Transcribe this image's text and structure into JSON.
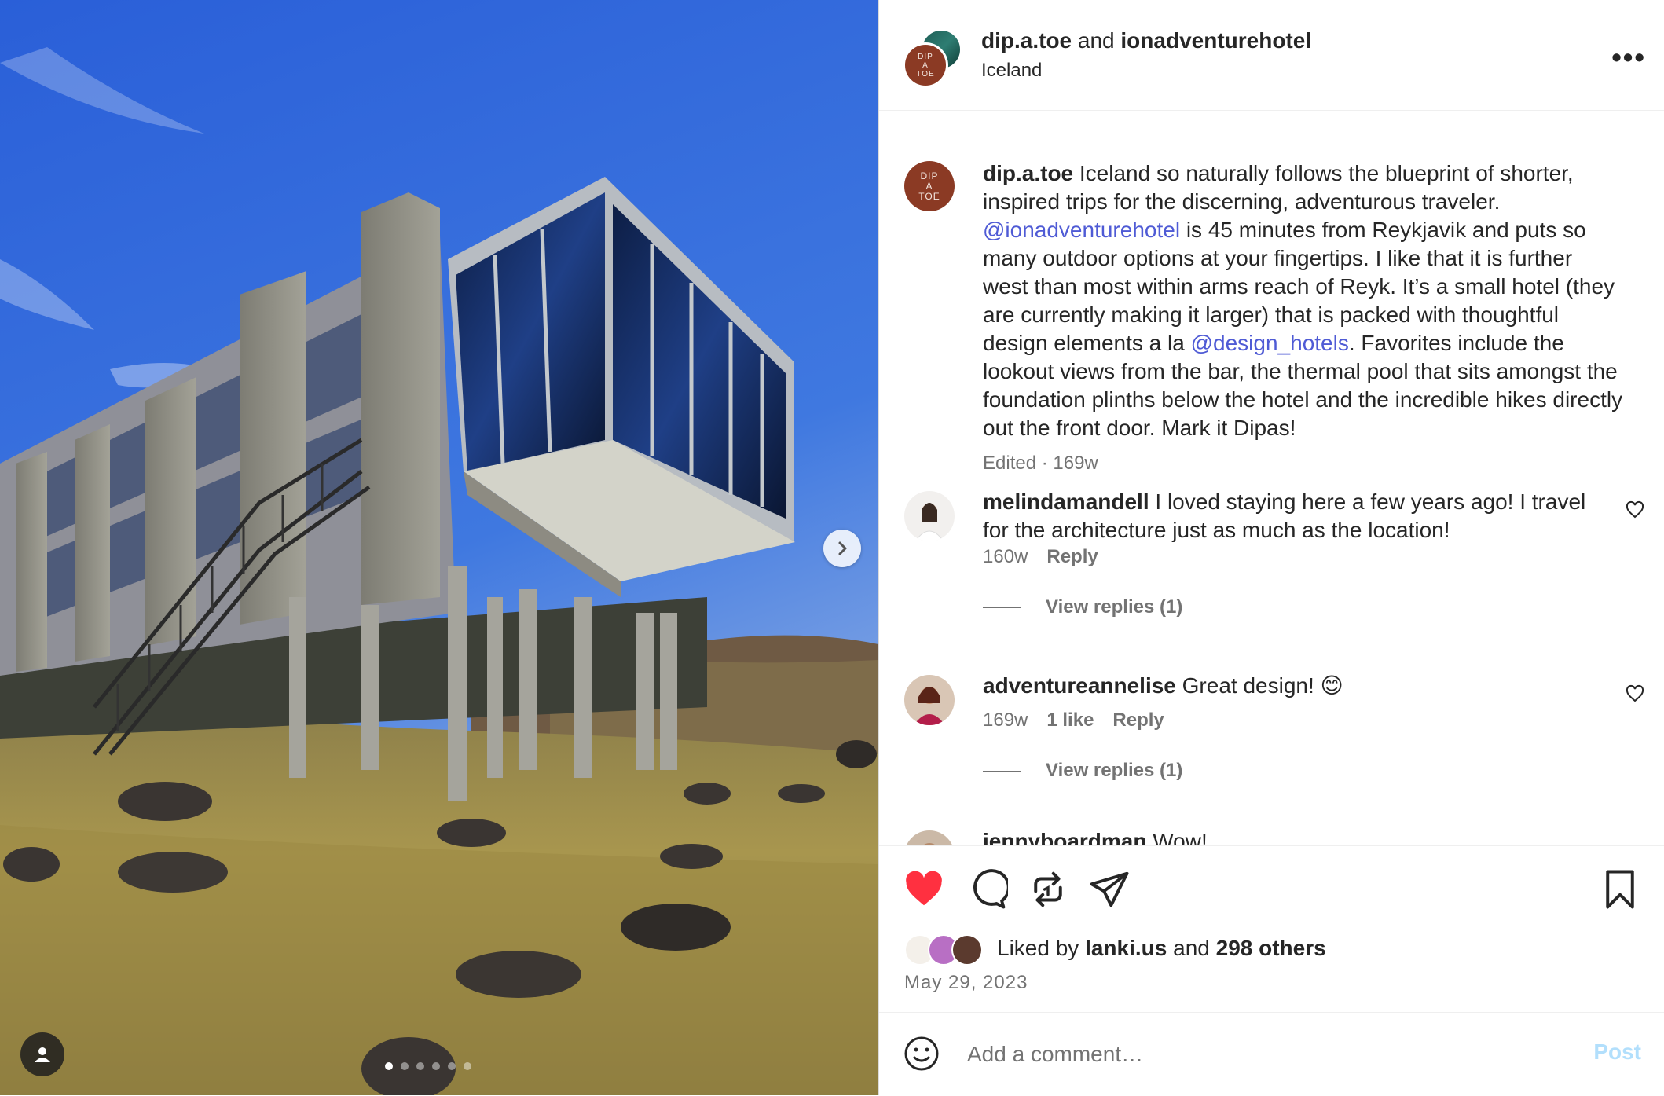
{
  "header": {
    "user1": "dip.a.toe",
    "joiner": "and",
    "user2": "ionadventurehotel",
    "location": "Iceland",
    "avatar_text": "DIP\nA\nTOE",
    "more_icon": "more-horizontal-icon"
  },
  "caption": {
    "username": "dip.a.toe",
    "text_1": " Iceland so naturally follows the blueprint of shorter, inspired trips for the discerning, adventurous traveler. ",
    "mention_1": "@ionadventurehotel",
    "text_2": " is 45 minutes from Reykjavik and puts so many outdoor options at your fingertips. I like that it is further west than most within arms reach of Reyk. It’s a small hotel (they are currently making it larger) that is packed with thoughtful design elements a la ",
    "mention_2": "@design_hotels",
    "text_3": ". Favorites include the lookout views from the bar, the thermal pool that sits amongst the foundation plinths below the hotel and the incredible hikes directly out the front door. Mark it Dipas!",
    "meta": "Edited · 169w"
  },
  "comments": [
    {
      "username": "melindamandell",
      "text": " I loved staying here a few years ago! I travel for the architecture just as much as the location!",
      "age": "160w",
      "reply": "Reply",
      "view_replies": "View replies (1)"
    },
    {
      "username": "adventureannelise",
      "text": " Great design! 😊",
      "age": "169w",
      "likes": "1 like",
      "reply": "Reply",
      "view_replies": "View replies (1)"
    },
    {
      "username": "jennyboardman",
      "text": " Wow!"
    }
  ],
  "actions": {
    "liked_by_prefix": "Liked by ",
    "liked_by_user": "lanki.us",
    "liked_by_and": " and ",
    "liked_by_others": "298 others",
    "date": "May 29, 2023",
    "like_color": "#ff3040"
  },
  "comment_bar": {
    "placeholder": "Add a comment…",
    "post_label": "Post"
  },
  "carousel": {
    "slide_count": 6,
    "active_index": 0
  }
}
